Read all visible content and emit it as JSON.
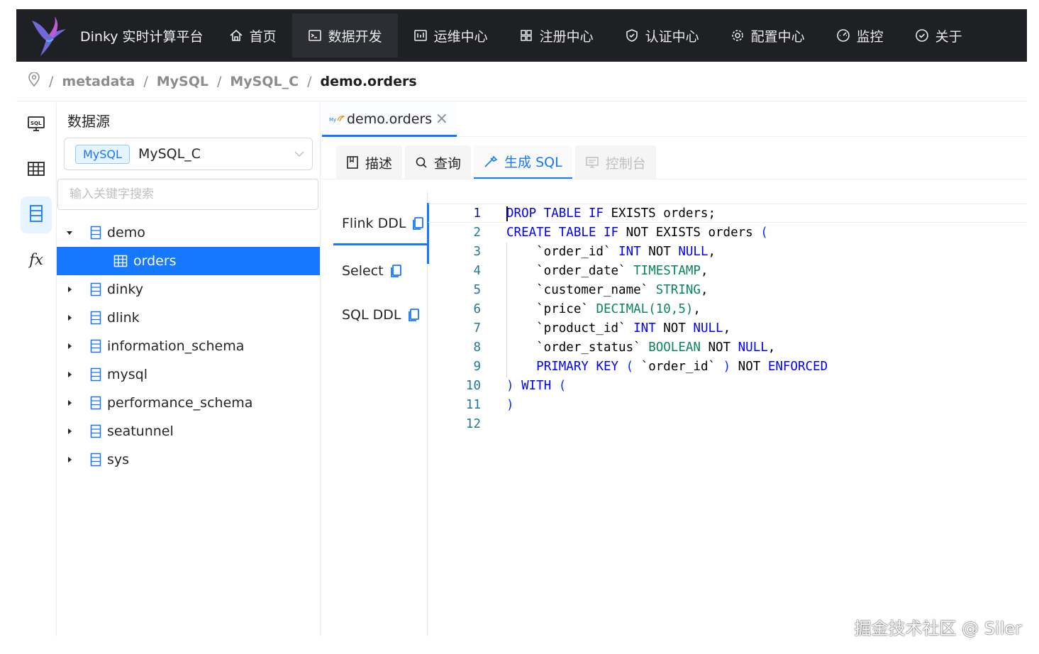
{
  "header": {
    "brand": "Dinky 实时计算平台",
    "nav": [
      {
        "label": "首页",
        "icon": "home-icon"
      },
      {
        "label": "数据开发",
        "icon": "terminal-icon",
        "active": true
      },
      {
        "label": "运维中心",
        "icon": "ops-icon"
      },
      {
        "label": "注册中心",
        "icon": "grid-icon"
      },
      {
        "label": "认证中心",
        "icon": "shield-icon"
      },
      {
        "label": "配置中心",
        "icon": "gear-icon"
      },
      {
        "label": "监控",
        "icon": "dashboard-icon"
      },
      {
        "label": "关于",
        "icon": "check-circle-icon"
      }
    ]
  },
  "breadcrumb": {
    "items": [
      "metadata",
      "MySQL",
      "MySQL_C"
    ],
    "current": "demo.orders",
    "separator": "/"
  },
  "sidebar": {
    "title": "数据源",
    "datasource_tag": "MySQL",
    "datasource_value": "MySQL_C",
    "search_placeholder": "输入关键字搜索",
    "tree": [
      {
        "label": "demo",
        "expanded": true
      },
      {
        "label": "orders",
        "child": true,
        "selected": true
      },
      {
        "label": "dinky"
      },
      {
        "label": "dlink"
      },
      {
        "label": "information_schema"
      },
      {
        "label": "mysql"
      },
      {
        "label": "performance_schema"
      },
      {
        "label": "seatunnel"
      },
      {
        "label": "sys"
      }
    ]
  },
  "main": {
    "file_tab": "demo.orders",
    "subtabs": [
      {
        "label": "描述"
      },
      {
        "label": "查询"
      },
      {
        "label": "生成 SQL",
        "active": true
      },
      {
        "label": "控制台",
        "disabled": true
      }
    ],
    "ddl_tabs": [
      "Flink DDL",
      "Select",
      "SQL DDL"
    ],
    "code_lines": [
      "1",
      "2",
      "3",
      "4",
      "5",
      "6",
      "7",
      "8",
      "9",
      "10",
      "11",
      "12"
    ]
  },
  "watermark": "掘金技术社区 @ Siler",
  "colors": {
    "accent": "#1677ff",
    "topbar": "#1f2023"
  }
}
